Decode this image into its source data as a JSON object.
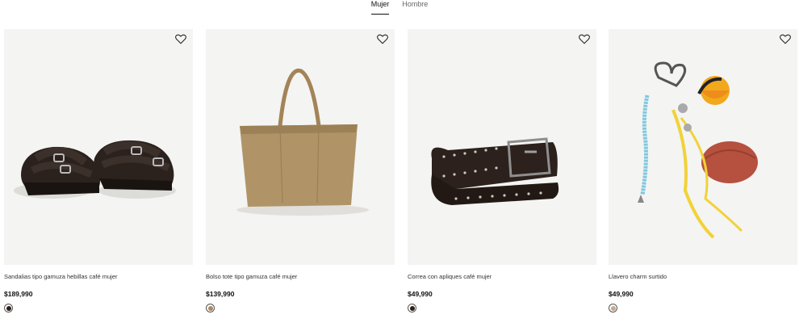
{
  "tabs": [
    {
      "label": "Mujer",
      "active": true
    },
    {
      "label": "Hombre",
      "active": false
    }
  ],
  "products": [
    {
      "name": "Sandalias tipo gamuza hebillas café mujer",
      "price": "$189,990",
      "icon": "sandals-image",
      "swatch_color": "#2a1f1a"
    },
    {
      "name": "Bolso tote tipo gamuza café mujer",
      "price": "$139,990",
      "icon": "tote-bag-image",
      "swatch_color": "#a88a5c"
    },
    {
      "name": "Correa con apliques café mujer",
      "price": "$49,990",
      "icon": "belt-image",
      "swatch_color": "#2f1e18"
    },
    {
      "name": "Llavero charm surtido",
      "price": "$49,990",
      "icon": "keychain-image",
      "swatch_color": "#c8a890"
    }
  ]
}
